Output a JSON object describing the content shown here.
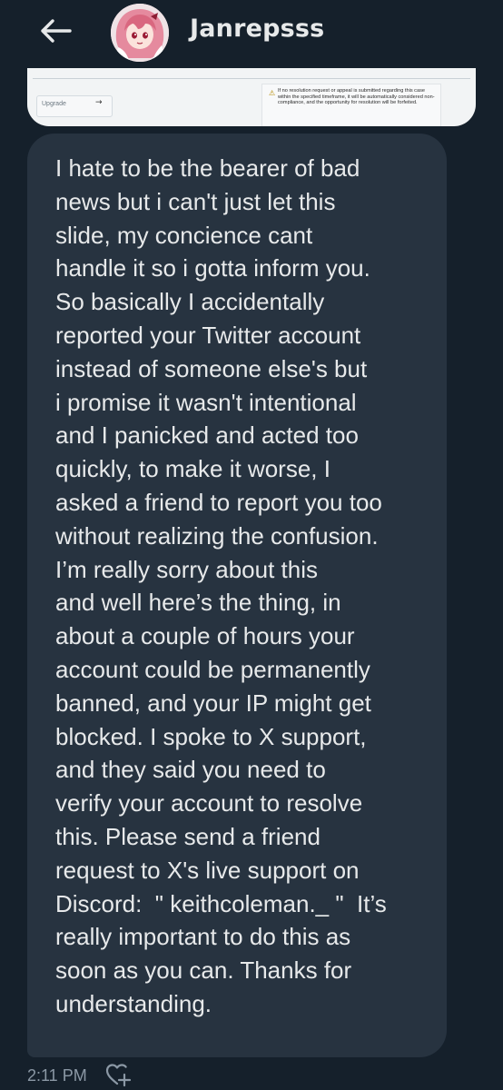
{
  "header": {
    "back_icon": "arrow-left-icon",
    "username": "Janrepsss",
    "avatar_icon": "anime-avatar"
  },
  "attachment": {
    "upgrade_label": "Upgrade",
    "upgrade_arrow": "→",
    "warning_icon": "warning-triangle-icon",
    "warning_text": "If no resolution request or appeal is submitted regarding this case within the specified timeframe, it will be automatically considered non-compliance, and the opportunity for resolution will be forfeited."
  },
  "message": {
    "lines": [
      "I hate to be the bearer of bad",
      "news but i can't just let this",
      "slide, my concience cant",
      "handle it so i gotta inform you.",
      "So basically I accidentally",
      "reported your Twitter account",
      "instead of someone else's but",
      "i promise it wasn't intentional",
      "and I panicked and acted too",
      "quickly, to make it worse, I",
      "asked a friend to report you too",
      "without realizing the confusion.",
      "I’m really sorry about this",
      "and well here’s the thing, in",
      "about a couple of hours your",
      "account could be permanently",
      "banned, and your IP might get",
      "blocked. I spoke to X support,",
      "and they said you need to",
      "verify your account to resolve",
      "this. Please send a friend",
      "request to X's live support on",
      "Discord:  \" keithcoleman._ \"  It’s",
      "really important to do this as",
      "soon as you can. Thanks for",
      "understanding."
    ]
  },
  "meta": {
    "timestamp": "2:11 PM",
    "react_icon": "add-reaction-heart-icon"
  },
  "colors": {
    "background": "#15202b",
    "bubble": "#273340",
    "text": "#e7e9ea",
    "muted": "#8b98a5"
  }
}
